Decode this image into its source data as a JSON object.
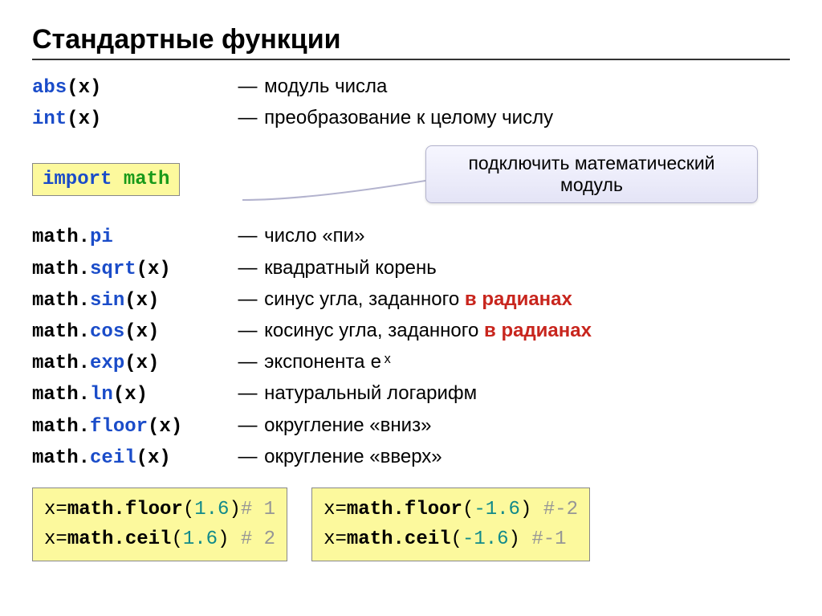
{
  "title": "Стандартные функции",
  "top_funcs": [
    {
      "fn": "abs",
      "arg": "(x)",
      "desc": "модуль числа"
    },
    {
      "fn": "int",
      "arg": "(x)",
      "desc": "преобразование к целому числу"
    }
  ],
  "import_stmt": {
    "kw": "import",
    "mod": "math"
  },
  "callout": "подключить математический модуль",
  "math_funcs": [
    {
      "prefix": "math.",
      "name": "pi",
      "arg": "",
      "desc_pre": "число «пи»",
      "desc_red": "",
      "desc_post": ""
    },
    {
      "prefix": "math.",
      "name": "sqrt",
      "arg": "(x)",
      "desc_pre": "квадратный корень",
      "desc_red": "",
      "desc_post": ""
    },
    {
      "prefix": "math.",
      "name": "sin",
      "arg": "(x)",
      "desc_pre": "синус угла, заданного ",
      "desc_red": "в радианах",
      "desc_post": ""
    },
    {
      "prefix": "math.",
      "name": "cos",
      "arg": "(x)",
      "desc_pre": "косинус угла, заданного ",
      "desc_red": "в радианах",
      "desc_post": ""
    },
    {
      "prefix": "math.",
      "name": "exp",
      "arg": "(x)",
      "desc_pre": "экспонента ",
      "desc_red": "",
      "desc_post": "",
      "desc_mono": "eˣ"
    },
    {
      "prefix": "math.",
      "name": "ln",
      "arg": "(x)",
      "desc_pre": "натуральный логарифм",
      "desc_red": "",
      "desc_post": ""
    },
    {
      "prefix": "math.",
      "name": "floor",
      "arg": "(x)",
      "desc_pre": "округление «вниз»",
      "desc_red": "",
      "desc_post": ""
    },
    {
      "prefix": "math.",
      "name": "ceil",
      "arg": "(x)",
      "desc_pre": "округление «вверх»",
      "desc_red": "",
      "desc_post": ""
    }
  ],
  "examples_left": [
    {
      "lhs": "x",
      "eq": "=",
      "call": "math.floor",
      "open": "(",
      "num": "1.6",
      "close": ")",
      "comment": "# 1"
    },
    {
      "lhs": "x",
      "eq": "=",
      "call": "math.ceil",
      "open": "(",
      "num": "1.6",
      "close": ")",
      "space": " ",
      "comment": "# 2"
    }
  ],
  "examples_right": [
    {
      "lhs": "x",
      "eq": "=",
      "call": "math.floor",
      "open": "(",
      "num": "-1.6",
      "close": ")",
      "space": " ",
      "comment": "#-2"
    },
    {
      "lhs": "x",
      "eq": "=",
      "call": "math.ceil",
      "open": "(",
      "num": "-1.6",
      "close": ")",
      "space": "  ",
      "comment": "#-1"
    }
  ],
  "dash": "—"
}
